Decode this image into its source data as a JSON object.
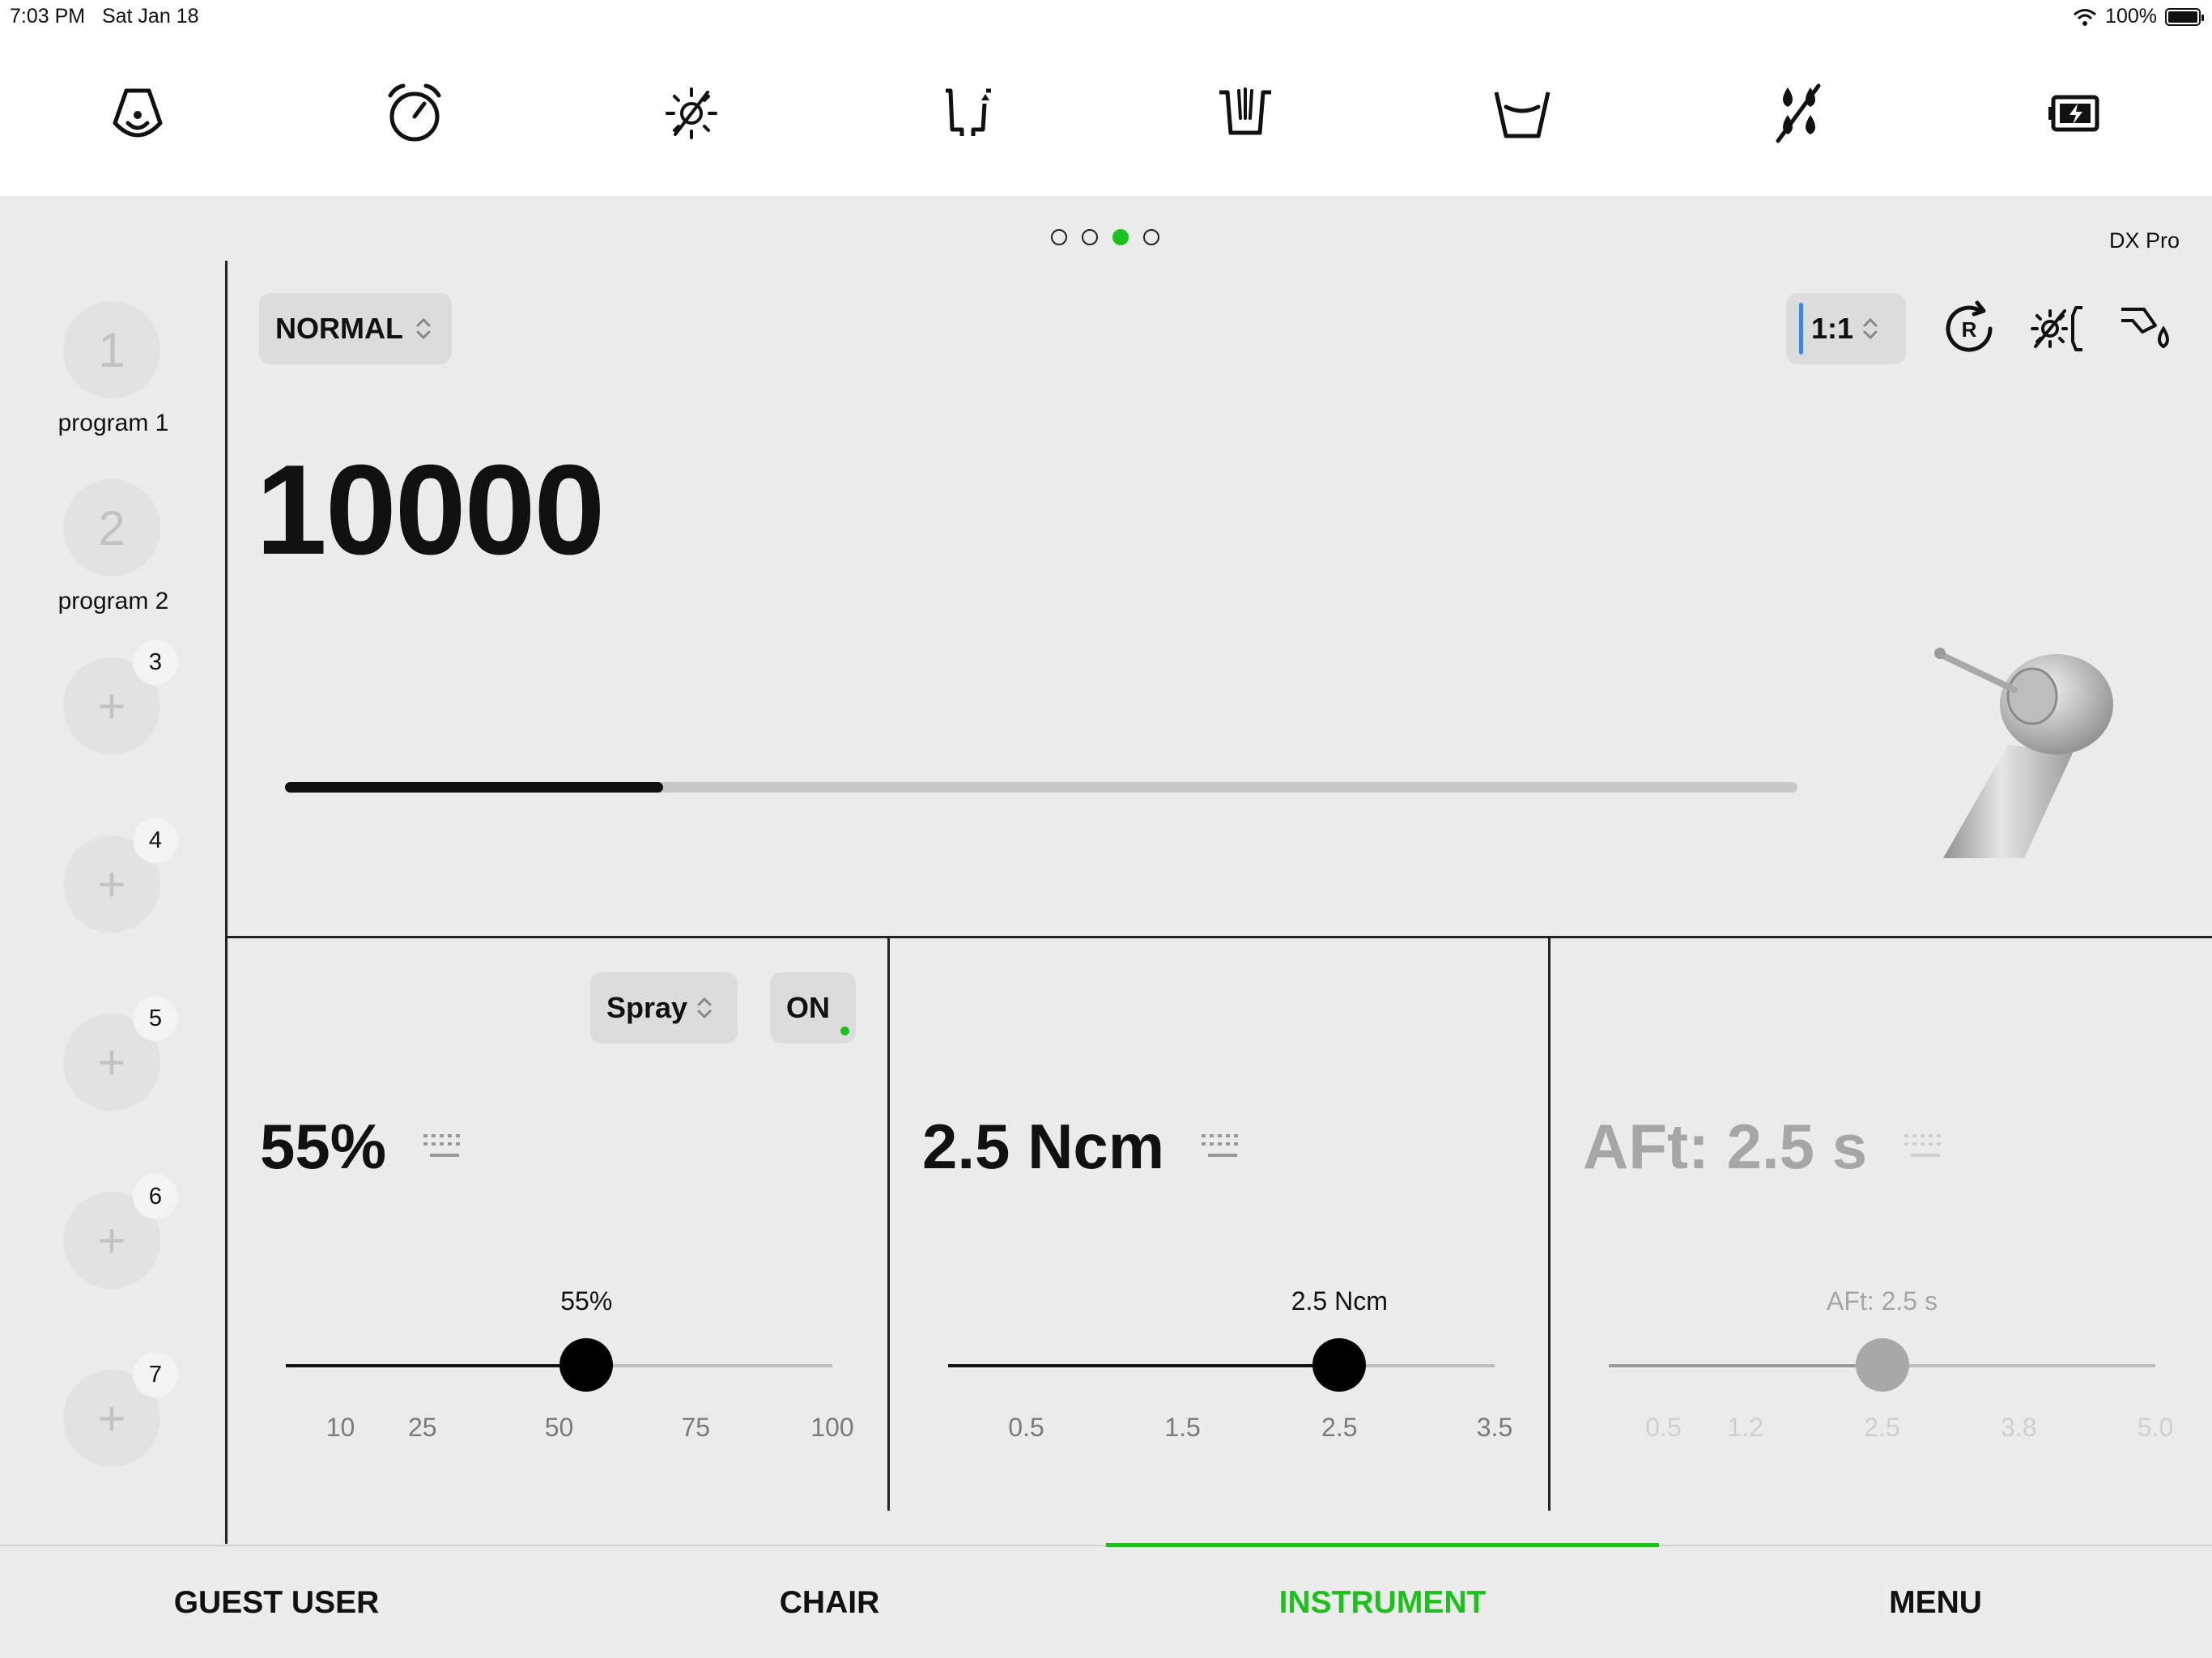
{
  "status": {
    "time": "7:03 PM",
    "date": "Sat Jan 18",
    "battery": "100%"
  },
  "toolbar": {
    "items": [
      {
        "icon": "dental-lamp-icon"
      },
      {
        "icon": "timer-icon"
      },
      {
        "icon": "light-off-icon"
      },
      {
        "icon": "chair-position-icon"
      },
      {
        "icon": "suction-icon"
      },
      {
        "icon": "water-cup-icon"
      },
      {
        "icon": "water-off-icon"
      },
      {
        "icon": "battery-charge-icon"
      }
    ]
  },
  "pager": {
    "count": 4,
    "active": 2
  },
  "model_name": "DX Pro",
  "programs": [
    {
      "number": "1",
      "label": "program 1"
    },
    {
      "number": "2",
      "label": "program 2"
    },
    {
      "number": "+",
      "badge": "3"
    },
    {
      "number": "+",
      "badge": "4"
    },
    {
      "number": "+",
      "badge": "5"
    },
    {
      "number": "+",
      "badge": "6"
    },
    {
      "number": "+",
      "badge": "7"
    }
  ],
  "instrument": {
    "mode": "NORMAL",
    "ratio": "1:1",
    "speed": "10000",
    "speed_fraction": 0.25,
    "header_icons": [
      "reverse-rotation-icon",
      "light-icon",
      "spray-water-icon"
    ]
  },
  "panels": {
    "spray": {
      "select_label": "Spray",
      "toggle_label": "ON",
      "value": "55%",
      "slider": {
        "label": "55%",
        "fraction": 0.55,
        "ticks": [
          "10",
          "25",
          "50",
          "75",
          "100"
        ],
        "tick_fractions": [
          0.1,
          0.25,
          0.5,
          0.75,
          1.0
        ]
      }
    },
    "torque": {
      "value": "2.5 Ncm",
      "slider": {
        "label": "2.5 Ncm",
        "fraction": 0.716,
        "ticks": [
          "0.5",
          "1.5",
          "2.5",
          "3.5"
        ],
        "tick_fractions": [
          0.143,
          0.429,
          0.716,
          1.0
        ]
      }
    },
    "aft": {
      "value": "AFt: 2.5 s",
      "slider": {
        "label": "AFt: 2.5 s",
        "fraction": 0.5,
        "ticks": [
          "0.5",
          "1.2",
          "2.5",
          "3.8",
          "5.0"
        ],
        "tick_fractions": [
          0.1,
          0.25,
          0.5,
          0.75,
          1.0
        ]
      }
    }
  },
  "bottom_nav": {
    "items": [
      "GUEST USER",
      "CHAIR",
      "INSTRUMENT",
      "MENU"
    ],
    "active": 2
  }
}
